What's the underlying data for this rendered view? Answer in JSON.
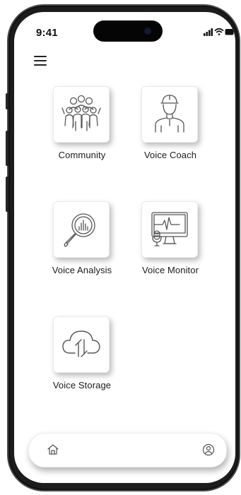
{
  "status_bar": {
    "time": "9:41",
    "icons": [
      "signal-icon",
      "wifi-icon",
      "battery-icon"
    ]
  },
  "header": {
    "menu_icon": "hamburger-menu-icon"
  },
  "tiles": [
    {
      "label": "Community",
      "icon": "community-group-icon"
    },
    {
      "label": "Voice Coach",
      "icon": "coach-person-icon"
    },
    {
      "label": "Voice Analysis",
      "icon": "magnifier-chart-icon"
    },
    {
      "label": "Voice Monitor",
      "icon": "monitor-microphone-icon"
    },
    {
      "label": "Voice Storage",
      "icon": "cloud-sync-icon"
    }
  ],
  "bottom_nav": {
    "items": [
      {
        "icon": "home-icon"
      },
      {
        "icon": "profile-icon"
      }
    ]
  },
  "colors": {
    "frame": "#1c1c1c",
    "screen": "#ffffff",
    "text": "#1a1a1a",
    "icon_stroke": "#555555"
  }
}
